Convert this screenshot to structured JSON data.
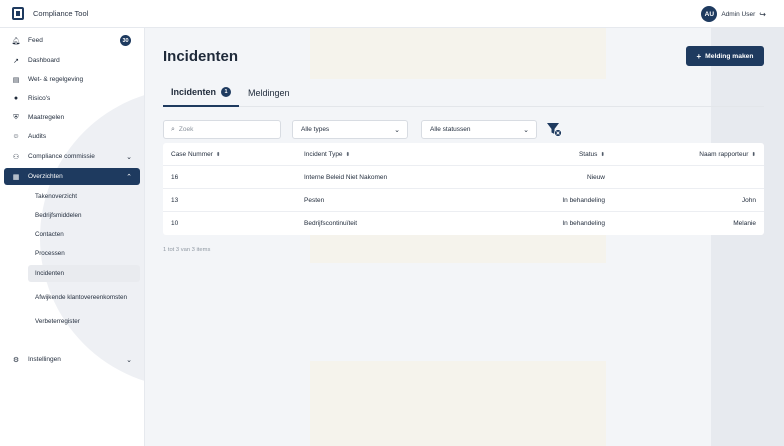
{
  "app": {
    "name": "Compliance Tool"
  },
  "user": {
    "initials": "AU",
    "name": "Admin User"
  },
  "sidebar": {
    "items": [
      {
        "label": "Feed",
        "badge": "30"
      },
      {
        "label": "Dashboard"
      },
      {
        "label": "Wet- & regelgeving"
      },
      {
        "label": "Risico's"
      },
      {
        "label": "Maatregelen"
      },
      {
        "label": "Audits"
      },
      {
        "label": "Compliance commissie"
      },
      {
        "label": "Overzichten"
      }
    ],
    "subitems": [
      {
        "label": "Takenoverzicht"
      },
      {
        "label": "Bedrijfsmiddelen"
      },
      {
        "label": "Contacten"
      },
      {
        "label": "Processen"
      },
      {
        "label": "Incidenten"
      },
      {
        "label": "Afwijkende klantovereenkomsten"
      },
      {
        "label": "Verbeterregister"
      }
    ],
    "settings": {
      "label": "Instellingen"
    }
  },
  "page": {
    "title": "Incidenten",
    "primary_button": "Melding maken",
    "tabs": [
      {
        "label": "Incidenten",
        "badge": "1"
      },
      {
        "label": "Meldingen"
      }
    ],
    "search": {
      "placeholder": "Zoek"
    },
    "filters": {
      "type": "Alle types",
      "status": "Alle statussen"
    },
    "table": {
      "columns": [
        "Case Nummer",
        "Incident Type",
        "Status",
        "Naam rapporteur"
      ],
      "rows": [
        [
          "16",
          "Interne Beleid Niet Nakomen",
          "Nieuw",
          ""
        ],
        [
          "13",
          "Pesten",
          "In behandeling",
          "John"
        ],
        [
          "10",
          "Bedrijfscontinuïteit",
          "In behandeling",
          "Melanie"
        ]
      ]
    },
    "pagination": "1 tot 3 van 3 items"
  },
  "colors": {
    "primary": "#1e3a5f",
    "background": "#f3f5f8"
  }
}
